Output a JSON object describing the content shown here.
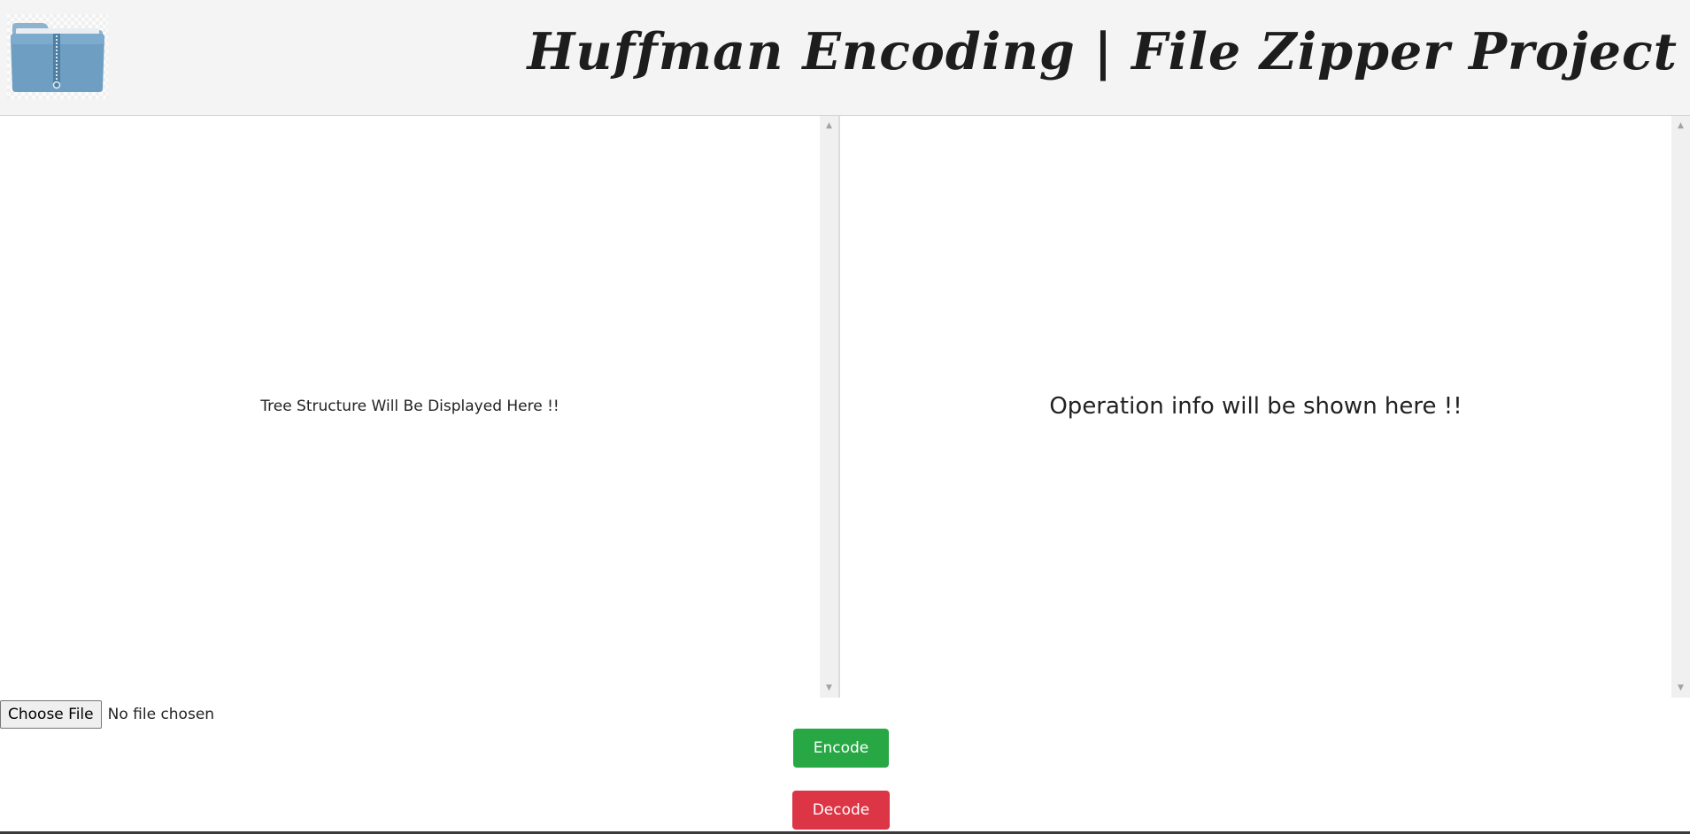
{
  "header": {
    "logo_icon": "zip-folder-icon",
    "title": "Huffman Encoding | File Zipper Project"
  },
  "panels": {
    "left": {
      "placeholder": "Tree Structure Will Be Displayed Here !!"
    },
    "right": {
      "placeholder": "Operation info will be shown here !!"
    }
  },
  "file_input": {
    "button_label": "Choose File",
    "status": "No file chosen"
  },
  "actions": {
    "encode_label": "Encode",
    "decode_label": "Decode"
  },
  "colors": {
    "encode": "#28a745",
    "decode": "#dc3545",
    "header_bg": "#f4f4f4"
  }
}
